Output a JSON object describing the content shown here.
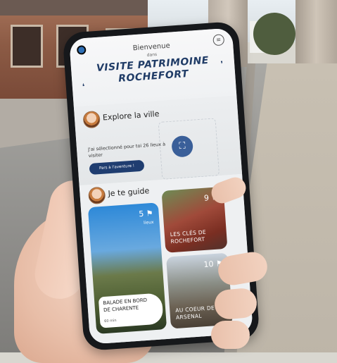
{
  "app": {
    "welcome": "Bienvenue",
    "welcome_sub": "dans",
    "title_line1": "VISITE PATRIMOINE",
    "title_line2": "ROCHEFORT"
  },
  "explore": {
    "title": "Explore la ville",
    "text": "J'ai sélectionné pour toi 26 lieux à visiter",
    "cta": "Pars à l'aventure !",
    "map_icon": "map-icon"
  },
  "guide": {
    "title": "Je te guide",
    "cards": [
      {
        "count": "5",
        "unit": "lieux",
        "label_line1": "BALADE EN BORD",
        "label_line2": "DE CHARENTE",
        "duration": "60 min"
      },
      {
        "count": "9",
        "label_line1": "LES CLÉS DE",
        "label_line2": "ROCHEFORT"
      },
      {
        "count": "10",
        "label_line1": "AU COEUR DE L",
        "label_line2": "ARSENAL"
      }
    ]
  },
  "colors": {
    "title": "#1f3b66",
    "cta_bg": "#1f3d70",
    "map_circle": "#3a5f99"
  }
}
